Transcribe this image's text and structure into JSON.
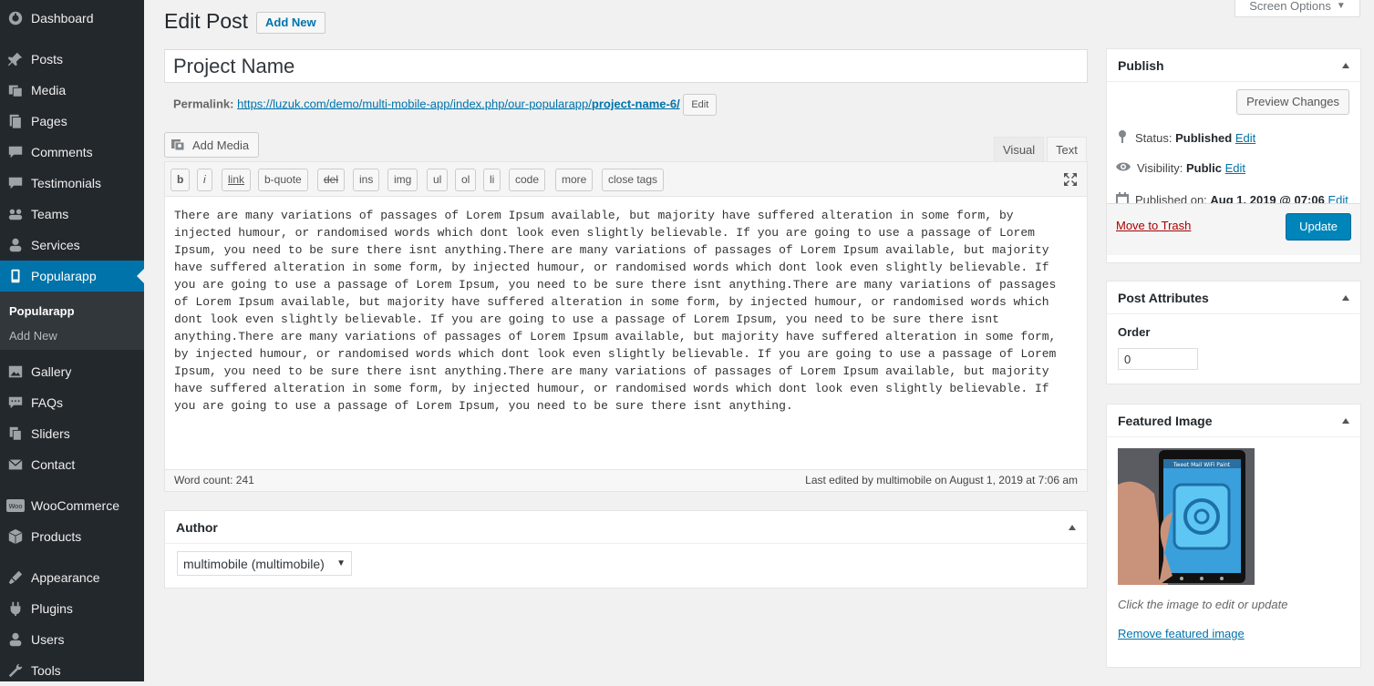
{
  "sidebar": {
    "items": [
      {
        "label": "Dashboard",
        "icon": "dashboard-icon"
      },
      {
        "label": "Posts",
        "icon": "pin-icon"
      },
      {
        "label": "Media",
        "icon": "media-icon"
      },
      {
        "label": "Pages",
        "icon": "pages-icon"
      },
      {
        "label": "Comments",
        "icon": "comments-icon"
      },
      {
        "label": "Testimonials",
        "icon": "testimonials-icon"
      },
      {
        "label": "Teams",
        "icon": "teams-icon"
      },
      {
        "label": "Services",
        "icon": "services-icon"
      },
      {
        "label": "Popularapp",
        "icon": "popularapp-icon"
      },
      {
        "label": "Gallery",
        "icon": "gallery-icon"
      },
      {
        "label": "FAQs",
        "icon": "faqs-icon"
      },
      {
        "label": "Sliders",
        "icon": "sliders-icon"
      },
      {
        "label": "Contact",
        "icon": "mail-icon"
      },
      {
        "label": "WooCommerce",
        "icon": "woocommerce-icon"
      },
      {
        "label": "Products",
        "icon": "products-icon"
      },
      {
        "label": "Appearance",
        "icon": "appearance-icon"
      },
      {
        "label": "Plugins",
        "icon": "plugins-icon"
      },
      {
        "label": "Users",
        "icon": "users-icon"
      },
      {
        "label": "Tools",
        "icon": "tools-icon"
      }
    ],
    "submenu": [
      {
        "label": "Popularapp"
      },
      {
        "label": "Add New"
      }
    ]
  },
  "header": {
    "title": "Edit Post",
    "add_new": "Add New",
    "screen_options": "Screen Options"
  },
  "post": {
    "title": "Project Name",
    "permalink_label": "Permalink:",
    "permalink_base": "https://luzuk.com/demo/multi-mobile-app/index.php/our-popularapp/",
    "permalink_slug": "project-name-6/",
    "permalink_edit": "Edit"
  },
  "editor": {
    "add_media": "Add Media",
    "tab_visual": "Visual",
    "tab_text": "Text",
    "toolbar": [
      "b",
      "i",
      "link",
      "b-quote",
      "del",
      "ins",
      "img",
      "ul",
      "ol",
      "li",
      "code",
      "more",
      "close tags"
    ],
    "content": "There are many variations of passages of Lorem Ipsum available, but majority have suffered alteration in some form, by\ninjected humour, or randomised words which dont look even slightly believable. If you are going to use a passage of Lorem\nIpsum, you need to be sure there isnt anything.There are many variations of passages of Lorem Ipsum available, but majority\nhave suffered alteration in some form, by injected humour, or randomised words which dont look even slightly believable. If\nyou are going to use a passage of Lorem Ipsum, you need to be sure there isnt anything.There are many variations of passages\nof Lorem Ipsum available, but majority have suffered alteration in some form, by injected humour, or randomised words which\ndont look even slightly believable. If you are going to use a passage of Lorem Ipsum, you need to be sure there isnt\nanything.There are many variations of passages of Lorem Ipsum available, but majority have suffered alteration in some form,\nby injected humour, or randomised words which dont look even slightly believable. If you are going to use a passage of Lorem\nIpsum, you need to be sure there isnt anything.There are many variations of passages of Lorem Ipsum available, but majority\nhave suffered alteration in some form, by injected humour, or randomised words which dont look even slightly believable. If\nyou are going to use a passage of Lorem Ipsum, you need to be sure there isnt anything.",
    "word_count": "Word count: 241",
    "last_edited": "Last edited by multimobile on August 1, 2019 at 7:06 am"
  },
  "author_box": {
    "title": "Author",
    "selected": "multimobile (multimobile)"
  },
  "publish_box": {
    "title": "Publish",
    "preview": "Preview Changes",
    "status_label": "Status:",
    "status_value": "Published",
    "visibility_label": "Visibility:",
    "visibility_value": "Public",
    "published_label": "Published on:",
    "published_value": "Aug 1, 2019 @ 07:06",
    "edit": "Edit",
    "trash": "Move to Trash",
    "update": "Update"
  },
  "attributes_box": {
    "title": "Post Attributes",
    "order_label": "Order",
    "order_value": "0"
  },
  "featured_box": {
    "title": "Featured Image",
    "phone_menu": "Tweet Mail WiFi Paint",
    "caption": "Click the image to edit or update",
    "remove": "Remove featured image"
  },
  "colors": {
    "sidebar_bg": "#23282d",
    "accent": "#0073aa",
    "update_button": "#0085ba",
    "trash": "#a00"
  }
}
